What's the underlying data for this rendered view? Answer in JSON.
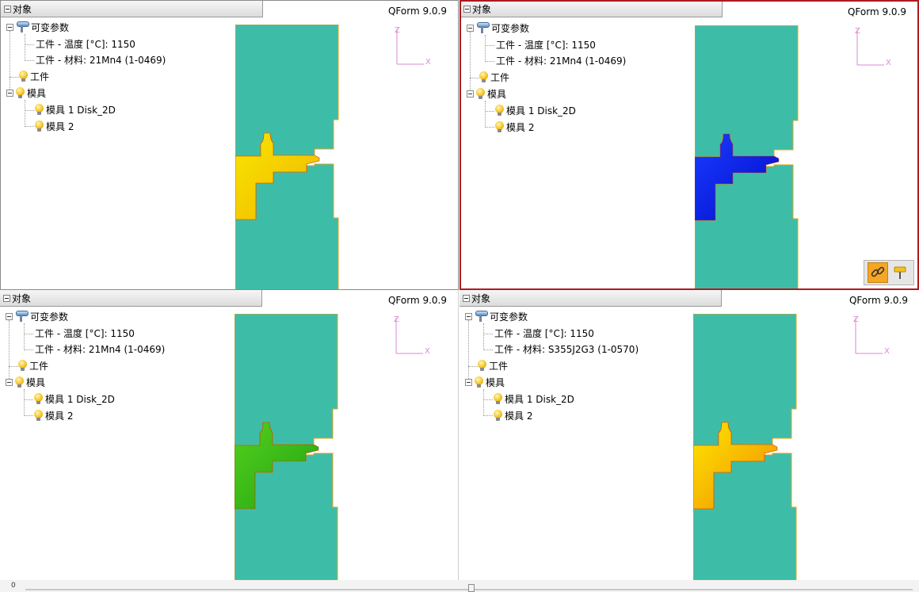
{
  "panes": [
    {
      "header": "对象",
      "brand": "QForm 9.0.9",
      "tree": {
        "params_label": "可变参数",
        "temp_row": "工件 - 温度 [°C]: 1150",
        "material_row": "工件 - 材料: 21Mn4 (1-0469)",
        "workpiece": "工件",
        "tools": "模具",
        "tool1": "模具 1 Disk_2D",
        "tool2": "模具 2"
      }
    },
    {
      "header": "对象",
      "brand": "QForm 9.0.9",
      "tree": {
        "params_label": "可变参数",
        "temp_row": "工件 - 温度 [°C]: 1150",
        "material_row": "工件 - 材料: 21Mn4 (1-0469)",
        "workpiece": "工件",
        "tools": "模具",
        "tool1": "模具 1 Disk_2D",
        "tool2": "模具 2"
      }
    },
    {
      "header": "对象",
      "brand": "QForm 9.0.9",
      "tree": {
        "params_label": "可变参数",
        "temp_row": "工件 - 温度 [°C]: 1150",
        "material_row": "工件 - 材料: 21Mn4 (1-0469)",
        "workpiece": "工件",
        "tools": "模具",
        "tool1": "模具 1 Disk_2D",
        "tool2": "模具 2"
      }
    },
    {
      "header": "对象",
      "brand": "QForm 9.0.9",
      "tree": {
        "params_label": "可变参数",
        "temp_row": "工件 - 温度 [°C]: 1150",
        "material_row": "工件 - 材料: S355J2G3 (1-0570)",
        "workpiece": "工件",
        "tools": "模具",
        "tool1": "模具 1 Disk_2D",
        "tool2": "模具 2"
      }
    }
  ],
  "axes": {
    "z": "Z",
    "x": "X"
  },
  "colors": {
    "die": "#3dbda8",
    "die_outline": "#e3a21a",
    "axis": "#d98ad2",
    "active_border": "#b0191e",
    "pane0_fill": [
      "#f7e600",
      "#f2b400"
    ],
    "pane1_fill": [
      "#1b3dff",
      "#0008c8"
    ],
    "pane2_fill": [
      "#55cf1c",
      "#1fa314"
    ],
    "pane3_fill": [
      "#ffe600",
      "#f08a00"
    ]
  },
  "slider": {
    "start_label": "0"
  }
}
